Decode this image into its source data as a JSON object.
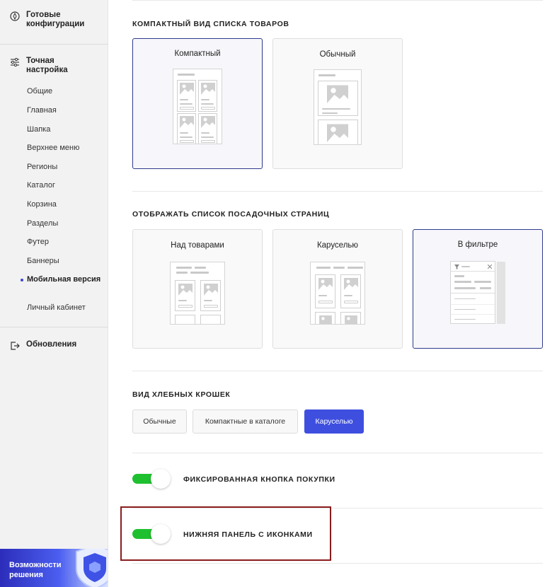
{
  "sidebar": {
    "ready_configs": "Готовые конфигурации",
    "fine_tuning": "Точная настройка",
    "items": [
      {
        "label": "Общие"
      },
      {
        "label": "Главная"
      },
      {
        "label": "Шапка"
      },
      {
        "label": "Верхнее меню"
      },
      {
        "label": "Регионы"
      },
      {
        "label": "Каталог"
      },
      {
        "label": "Корзина"
      },
      {
        "label": "Разделы"
      },
      {
        "label": "Футер"
      },
      {
        "label": "Баннеры"
      },
      {
        "label": "Мобильная версия",
        "active": true
      },
      {
        "label": "Личный кабинет"
      }
    ],
    "updates": "Обновления",
    "promo": "Возможности решения"
  },
  "main": {
    "list_view": {
      "title": "КОМПАКТНЫЙ ВИД СПИСКА ТОВАРОВ",
      "options": [
        {
          "label": "Компактный",
          "selected": true
        },
        {
          "label": "Обычный",
          "selected": false
        }
      ]
    },
    "landing": {
      "title": "ОТОБРАЖАТЬ СПИСОК ПОСАДОЧНЫХ СТРАНИЦ",
      "options": [
        {
          "label": "Над товарами",
          "selected": false
        },
        {
          "label": "Каруселью",
          "selected": false
        },
        {
          "label": "В фильтре",
          "selected": true
        }
      ]
    },
    "breadcrumbs": {
      "title": "ВИД ХЛЕБНЫХ КРОШЕК",
      "options": [
        {
          "label": "Обычные",
          "active": false
        },
        {
          "label": "Компактные в каталоге",
          "active": false
        },
        {
          "label": "Каруселью",
          "active": true
        }
      ]
    },
    "toggles": [
      {
        "label": "ФИКСИРОВАННАЯ КНОПКА ПОКУПКИ",
        "on": true
      },
      {
        "label": "НИЖНЯЯ ПАНЕЛЬ С ИКОНКАМИ",
        "on": true
      }
    ]
  },
  "colors": {
    "accent": "#3e4fe0",
    "toggle_on": "#1fc02f",
    "selected_border": "#2e3a8c",
    "highlight_border": "#8a1c1c"
  }
}
